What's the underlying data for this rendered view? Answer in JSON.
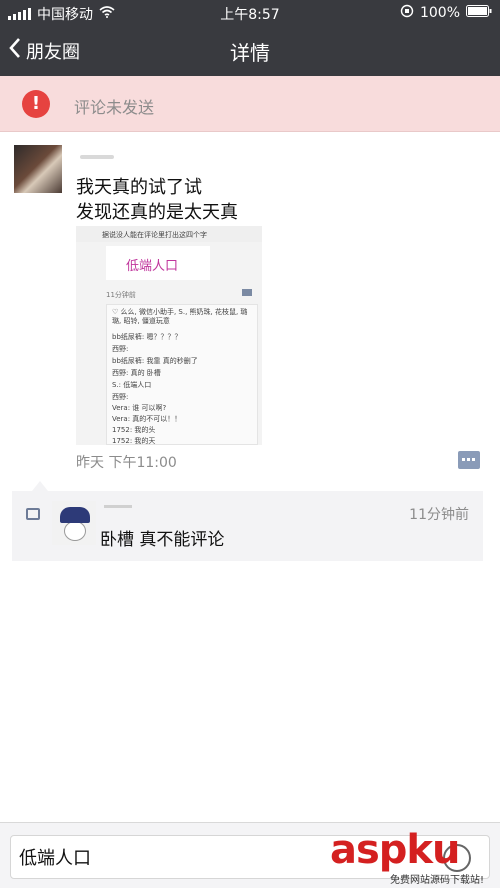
{
  "status_bar": {
    "carrier": "中国移动",
    "time": "上午8:57",
    "battery": "100%",
    "icons": [
      "signal-icon",
      "wifi-icon",
      "lock-rotation-icon",
      "battery-icon"
    ]
  },
  "nav": {
    "back_label": "朋友圈",
    "title": "详情"
  },
  "alert": {
    "icon": "exclamation-icon",
    "text": "评论未发送",
    "colors": {
      "background": "#f8dcdc",
      "icon": "#e64340"
    }
  },
  "post": {
    "text_line1": "我天真的试了试",
    "text_line2": "发现还真的是太天真",
    "time": "昨天 下午11:00",
    "image": {
      "header_text": "据说没人能在评论里打出这四个字",
      "card_text": "低端人口",
      "time": "11分钟前",
      "likes": "♡ 么么, 微信小助手, S., 熊奶珠, 花枝鼠, 璐璐, 昭铃, 僵道玩意",
      "comments": [
        "bb纸尿裤: 嗯？？？？",
        "西野:",
        "bb纸尿裤: 我靠 真的秒删了",
        "西野: 真的 卧槽",
        "S.: 低端人口",
        "西野:",
        "Vera: 谁 可以啊?",
        "Vera: 真的不可以！！",
        "1752: 我的头",
        "1752: 我的天"
      ]
    }
  },
  "comment": {
    "time": "11分钟前",
    "text": "卧槽 真不能评论"
  },
  "input": {
    "value": "低端人口"
  },
  "watermark": {
    "big": "aspku",
    "small": "免费网站源码下载站!"
  }
}
